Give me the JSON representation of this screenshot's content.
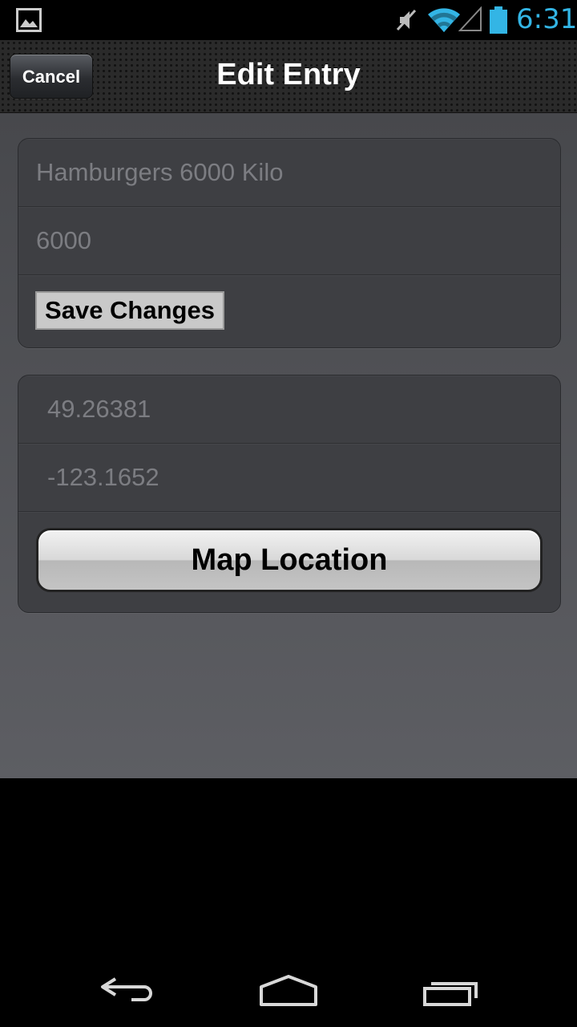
{
  "status_bar": {
    "time": "6:31",
    "icons": [
      "gallery-icon",
      "mute-icon",
      "wifi-icon",
      "signal-icon",
      "battery-icon"
    ],
    "accent_color": "#33b5e5"
  },
  "header": {
    "title": "Edit Entry",
    "cancel_label": "Cancel"
  },
  "entry": {
    "name_value": "Hamburgers 6000 Kilo",
    "quantity_value": "6000",
    "save_label": "Save Changes"
  },
  "location": {
    "latitude_value": "49.26381",
    "longitude_value": "-123.1652",
    "map_label": "Map Location"
  },
  "system_nav": {
    "icons": [
      "back-icon",
      "home-icon",
      "recent-apps-icon"
    ]
  }
}
